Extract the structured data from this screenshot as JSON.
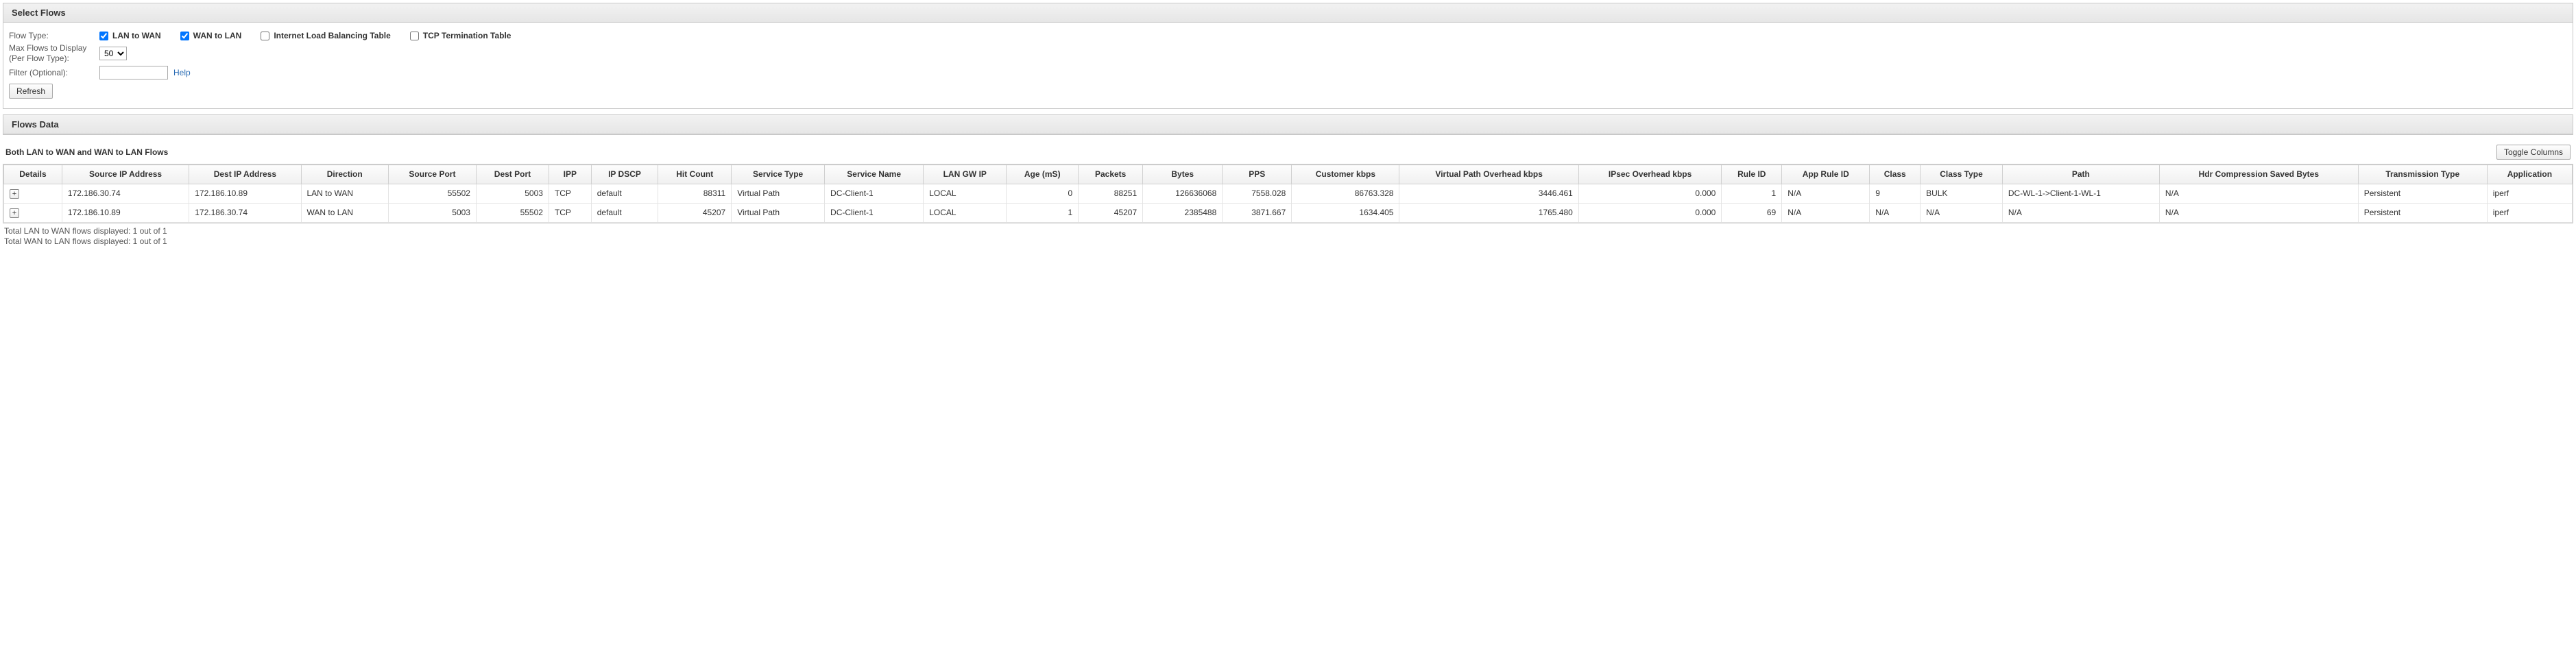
{
  "panel_select": {
    "title": "Select Flows",
    "flow_type_label": "Flow Type:",
    "checkboxes": [
      {
        "label": "LAN to WAN",
        "checked": true
      },
      {
        "label": "WAN to LAN",
        "checked": true
      },
      {
        "label": "Internet Load Balancing Table",
        "checked": false
      },
      {
        "label": "TCP Termination Table",
        "checked": false
      }
    ],
    "max_flows_label": "Max Flows to Display\n(Per Flow Type):",
    "max_flows_value": "50",
    "filter_label": "Filter (Optional):",
    "filter_value": "",
    "help_text": "Help",
    "refresh_label": "Refresh"
  },
  "panel_data": {
    "title": "Flows Data",
    "caption": "Both LAN to WAN and WAN to LAN Flows",
    "toggle_columns_label": "Toggle Columns",
    "columns": [
      "Details",
      "Source IP Address",
      "Dest IP Address",
      "Direction",
      "Source Port",
      "Dest Port",
      "IPP",
      "IP DSCP",
      "Hit Count",
      "Service Type",
      "Service Name",
      "LAN GW IP",
      "Age (mS)",
      "Packets",
      "Bytes",
      "PPS",
      "Customer kbps",
      "Virtual Path Overhead kbps",
      "IPsec Overhead kbps",
      "Rule ID",
      "App Rule ID",
      "Class",
      "Class Type",
      "Path",
      "Hdr Compression Saved Bytes",
      "Transmission Type",
      "Application"
    ],
    "rows": [
      {
        "src_ip": "172.186.30.74",
        "dst_ip": "172.186.10.89",
        "direction": "LAN to WAN",
        "src_port": "55502",
        "dst_port": "5003",
        "ipp": "TCP",
        "dscp": "default",
        "hit": "88311",
        "svc_type": "Virtual Path",
        "svc_name": "DC-Client-1",
        "lan_gw": "LOCAL",
        "age": "0",
        "packets": "88251",
        "bytes": "126636068",
        "pps": "7558.028",
        "cust_kbps": "86763.328",
        "vp_oh": "3446.461",
        "ipsec_oh": "0.000",
        "rule_id": "1",
        "app_rule": "N/A",
        "class": "9",
        "class_type": "BULK",
        "path": "DC-WL-1->Client-1-WL-1",
        "hdr_comp": "N/A",
        "tx_type": "Persistent",
        "app": "iperf"
      },
      {
        "src_ip": "172.186.10.89",
        "dst_ip": "172.186.30.74",
        "direction": "WAN to LAN",
        "src_port": "5003",
        "dst_port": "55502",
        "ipp": "TCP",
        "dscp": "default",
        "hit": "45207",
        "svc_type": "Virtual Path",
        "svc_name": "DC-Client-1",
        "lan_gw": "LOCAL",
        "age": "1",
        "packets": "45207",
        "bytes": "2385488",
        "pps": "3871.667",
        "cust_kbps": "1634.405",
        "vp_oh": "1765.480",
        "ipsec_oh": "0.000",
        "rule_id": "69",
        "app_rule": "N/A",
        "class": "N/A",
        "class_type": "N/A",
        "path": "N/A",
        "hdr_comp": "N/A",
        "tx_type": "Persistent",
        "app": "iperf"
      }
    ],
    "footer_line1": "Total LAN to WAN flows displayed: 1 out of 1",
    "footer_line2": "Total WAN to LAN flows displayed: 1 out of 1"
  }
}
